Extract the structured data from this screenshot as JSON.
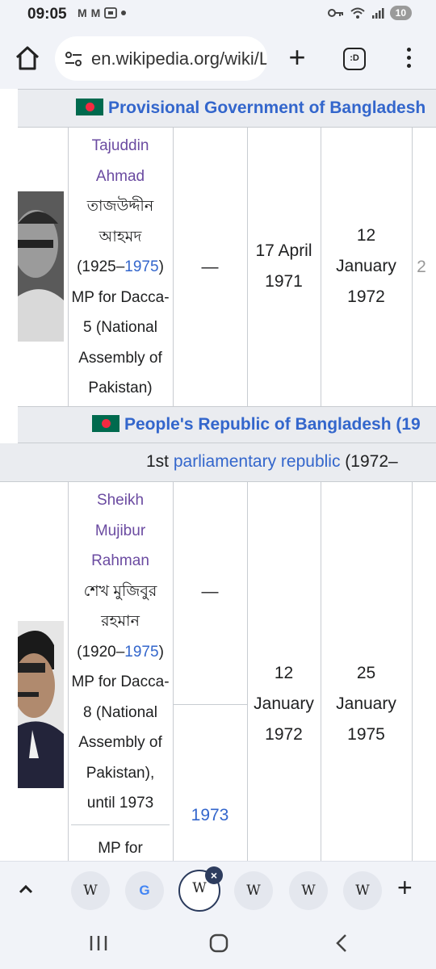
{
  "status_bar": {
    "time": "09:05",
    "notif_icons": [
      "M",
      "M"
    ],
    "battery": "10"
  },
  "toolbar": {
    "url": "en.wikipedia.org/wiki/L",
    "tabs_icon_text": ":D"
  },
  "table": {
    "section1_header": "Provisional Government of Bangladesh",
    "section2_header": "People's Republic of Bangladesh (19",
    "subheader_prefix": "1st ",
    "subheader_link": "parliamentary republic",
    "subheader_suffix": " (1972–",
    "row1": {
      "name": [
        "Tajuddin",
        "Ahmad"
      ],
      "native": [
        "তাজউদ্দীন",
        "আহমদ"
      ],
      "lifespan_prefix": "(1925–",
      "lifespan_link": "1975",
      "lifespan_suffix": ")",
      "constituency": [
        "MP for Dacca-",
        "5 (National",
        "Assembly of",
        "Pakistan)"
      ],
      "dash": "—",
      "start": [
        "17 April",
        "1971"
      ],
      "end": [
        "12",
        "January",
        "1972"
      ],
      "next_col": "2"
    },
    "row2": {
      "name": [
        "Sheikh",
        "Mujibur",
        "Rahman"
      ],
      "native": [
        "শেখ মুজিবুর",
        "রহমান"
      ],
      "lifespan_prefix": "(1920–",
      "lifespan_link": "1975",
      "lifespan_suffix": ")",
      "constituency": [
        "MP for Dacca-",
        "8 (National",
        "Assembly of",
        "Pakistan),",
        "until 1973"
      ],
      "constituency2": "MP for",
      "dash": "—",
      "year_link": "1973",
      "start": [
        "12",
        "January",
        "1972"
      ],
      "end": [
        "25",
        "January",
        "1975"
      ]
    }
  },
  "tabstrip": {
    "tabs": [
      "W",
      "G",
      "W",
      "W",
      "W",
      "W"
    ],
    "close": "×",
    "new_tab": "+"
  },
  "colors": {
    "link": "#3366cc",
    "visited_link": "#6b4ba1",
    "header_bg": "#eaecf0",
    "chrome_bg": "#f1f3f8"
  }
}
